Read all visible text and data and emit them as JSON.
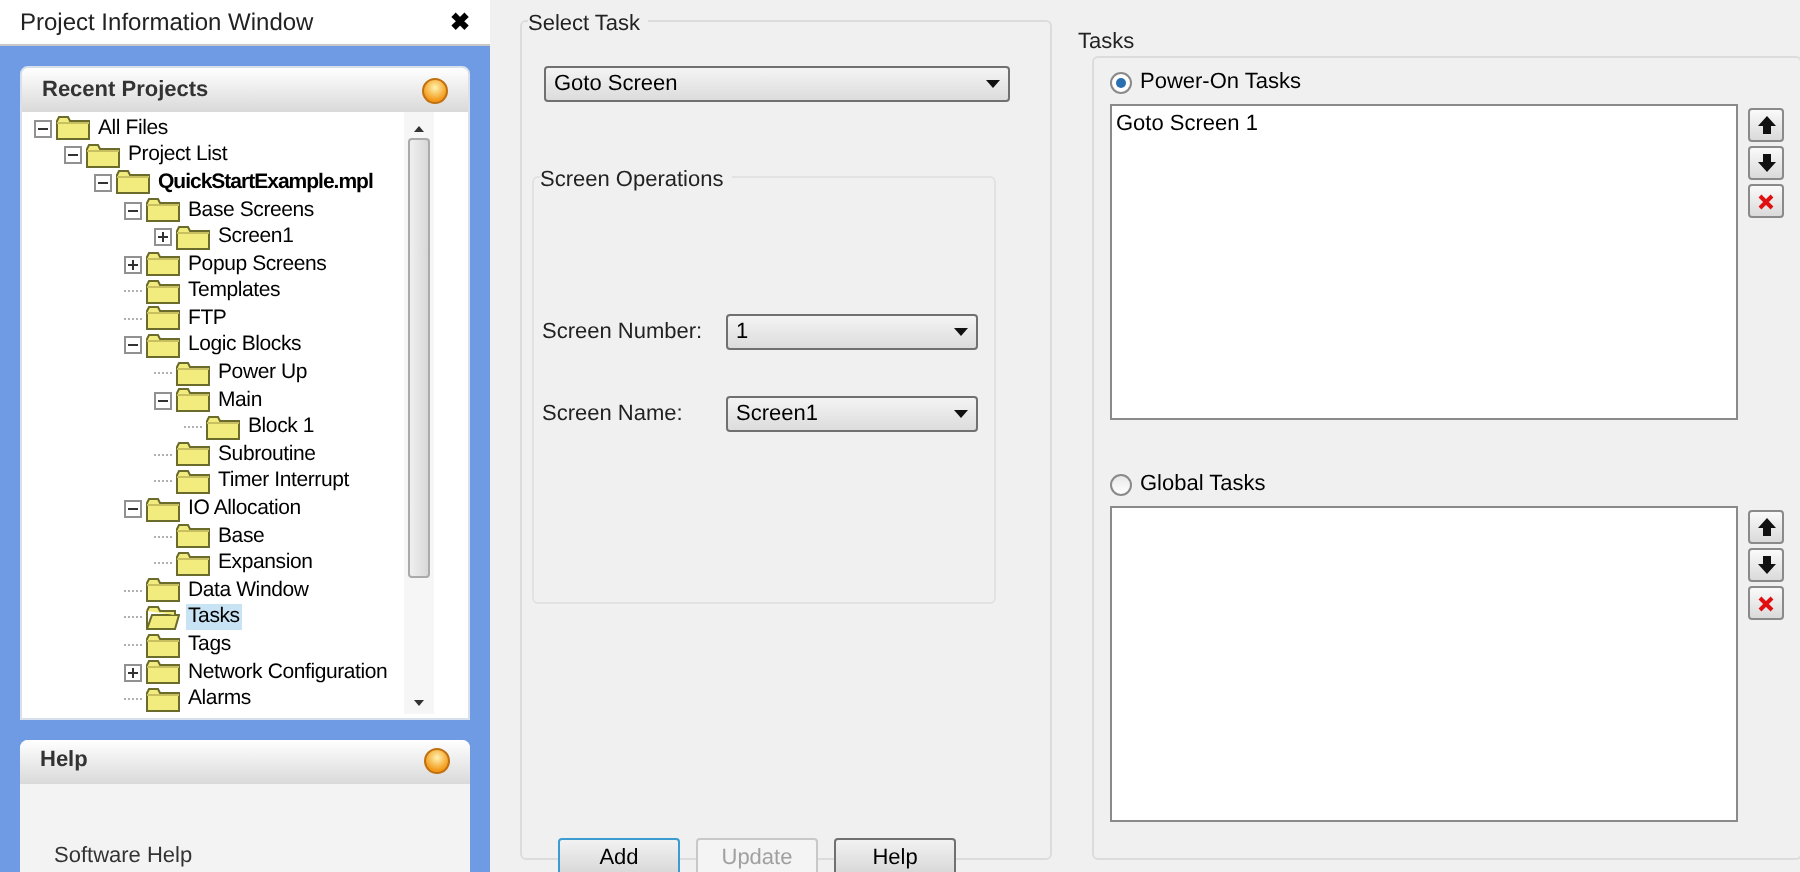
{
  "window": {
    "title": "Project Information Window",
    "close": "✖"
  },
  "recent_projects": {
    "title": "Recent Projects",
    "tree": [
      {
        "label": "All Files",
        "expanded": true,
        "selected": false,
        "children": [
          {
            "label": "Project List",
            "expanded": true,
            "selected": false,
            "children": [
              {
                "label": "QuickStartExample.mpl",
                "kind": "project",
                "expanded": true,
                "selected": false,
                "children": [
                  {
                    "label": "Base Screens",
                    "expanded": true,
                    "selected": false,
                    "children": [
                      {
                        "label": "Screen1",
                        "expanded": false,
                        "selected": false
                      }
                    ]
                  },
                  {
                    "label": "Popup Screens",
                    "expanded": false,
                    "selected": false
                  },
                  {
                    "label": "Templates",
                    "selected": false
                  },
                  {
                    "label": "FTP",
                    "selected": false
                  },
                  {
                    "label": "Logic Blocks",
                    "expanded": true,
                    "selected": false,
                    "children": [
                      {
                        "label": "Power Up",
                        "selected": false
                      },
                      {
                        "label": "Main",
                        "expanded": true,
                        "selected": false,
                        "children": [
                          {
                            "label": "Block 1",
                            "selected": false
                          }
                        ]
                      },
                      {
                        "label": "Subroutine",
                        "selected": false
                      },
                      {
                        "label": "Timer Interrupt",
                        "selected": false
                      }
                    ]
                  },
                  {
                    "label": "IO Allocation",
                    "expanded": true,
                    "selected": false,
                    "children": [
                      {
                        "label": "Base",
                        "selected": false
                      },
                      {
                        "label": "Expansion",
                        "selected": false
                      }
                    ]
                  },
                  {
                    "label": "Data Window",
                    "selected": false
                  },
                  {
                    "label": "Tasks",
                    "selected": true
                  },
                  {
                    "label": "Tags",
                    "selected": false
                  },
                  {
                    "label": "Network Configuration",
                    "expanded": false,
                    "selected": false
                  },
                  {
                    "label": "Alarms",
                    "selected": false
                  }
                ]
              }
            ]
          }
        ]
      }
    ]
  },
  "help": {
    "title": "Help",
    "items": [
      "Software Help"
    ]
  },
  "select_task": {
    "title": "Select Task",
    "value": "Goto Screen"
  },
  "screen_operations": {
    "title": "Screen Operations",
    "fields": [
      {
        "label": "Screen Number:",
        "value": "1"
      },
      {
        "label": "Screen Name:",
        "value": "Screen1"
      }
    ]
  },
  "buttons": [
    {
      "label": "Add",
      "disabled": false,
      "focused": true
    },
    {
      "label": "Update",
      "disabled": true
    },
    {
      "label": "Help",
      "disabled": false
    }
  ],
  "tasks": {
    "title": "Tasks",
    "groups": [
      {
        "label": "Power-On Tasks",
        "selected": true,
        "items": [
          "Goto Screen 1"
        ]
      },
      {
        "label": "Global Tasks",
        "selected": false
      }
    ]
  }
}
